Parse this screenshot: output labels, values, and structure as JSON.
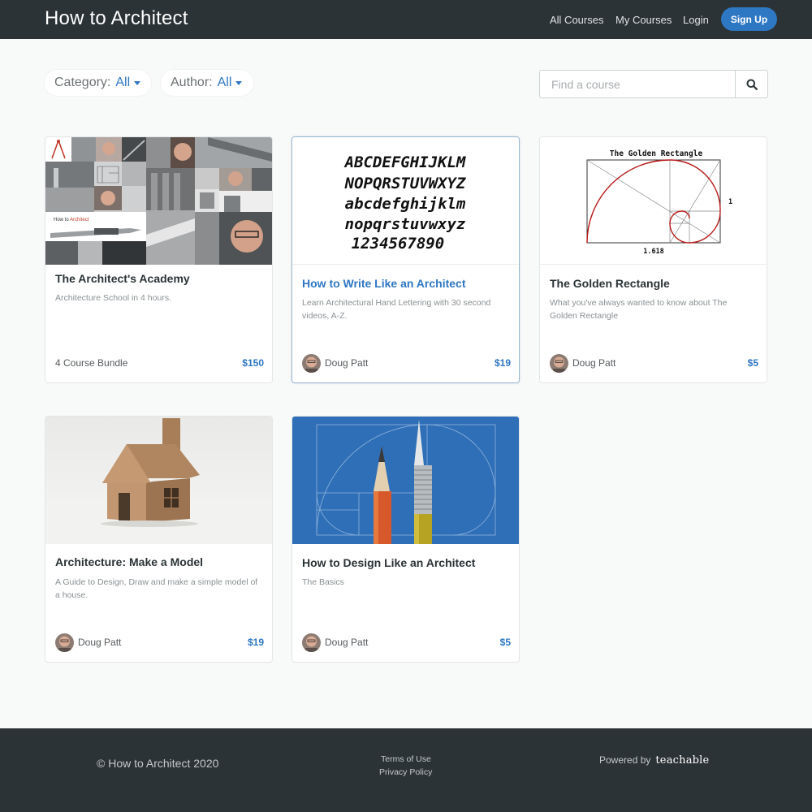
{
  "header": {
    "brand": "How to Architect",
    "nav": {
      "all_courses": "All Courses",
      "my_courses": "My Courses",
      "login": "Login",
      "signup": "Sign Up"
    }
  },
  "filters": {
    "category_label": "Category:",
    "category_value": "All",
    "author_label": "Author:",
    "author_value": "All"
  },
  "search": {
    "placeholder": "Find a course",
    "icon": "search-icon"
  },
  "courses": [
    {
      "title": "The Architect's Academy",
      "description": "Architecture School in 4 hours.",
      "footer_text": "4 Course Bundle",
      "price": "$150",
      "thumb_text": "How to Architect"
    },
    {
      "title": "How to Write Like an Architect",
      "description": "Learn Architectural Hand Lettering with 30 second videos, A-Z.",
      "author": "Doug Patt",
      "price": "$19",
      "lettering": [
        "ABCDEFGHIJKLM",
        "NOPQRSTUVWXYZ",
        "abcdefghijklm",
        "nopqrstuvwxyz",
        "1234567890"
      ]
    },
    {
      "title": "The Golden Rectangle",
      "description": "What you've always wanted to know about The Golden Rectangle",
      "author": "Doug Patt",
      "price": "$5",
      "diagram_title": "The Golden Rectangle",
      "diagram_side": "1",
      "diagram_bottom": "1.618"
    },
    {
      "title": "Architecture: Make a Model",
      "description": "A Guide to Design, Draw and make a simple model of a house.",
      "author": "Doug Patt",
      "price": "$19"
    },
    {
      "title": "How to Design Like an Architect",
      "description": "The Basics",
      "author": "Doug Patt",
      "price": "$5"
    }
  ],
  "footer": {
    "copyright": "© How to Architect 2020",
    "terms": "Terms of Use",
    "privacy": "Privacy Policy",
    "powered_by": "Powered by",
    "platform": "teachable"
  },
  "colors": {
    "header_bg": "#2b3336",
    "accent": "#2e77c2",
    "page_bg": "#f8f9f9"
  }
}
